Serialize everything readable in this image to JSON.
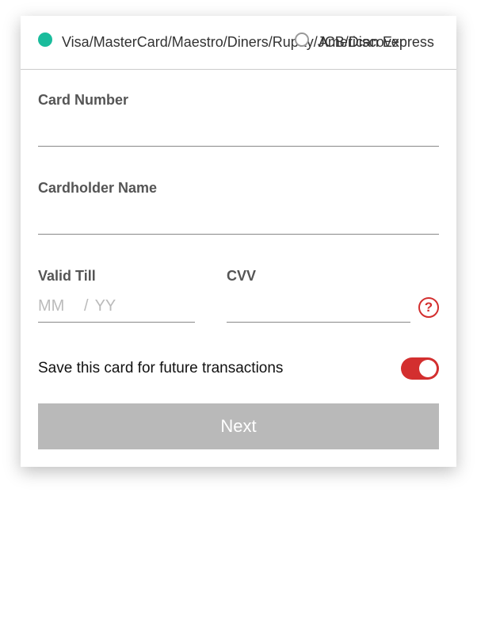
{
  "cardTypes": {
    "option1": "Visa/MasterCard/Maestro/Diners/Rupay/JCB/Discover",
    "option2": "American Express"
  },
  "fields": {
    "cardNumber": {
      "label": "Card Number",
      "value": ""
    },
    "cardholder": {
      "label": "Cardholder Name",
      "value": ""
    },
    "validTill": {
      "label": "Valid Till",
      "mmPlaceholder": "MM",
      "separator": "/",
      "yyPlaceholder": "YY"
    },
    "cvv": {
      "label": "CVV",
      "value": ""
    }
  },
  "help": {
    "symbol": "?"
  },
  "saveCard": {
    "label": "Save this card for future transactions",
    "on": true
  },
  "actions": {
    "next": "Next"
  }
}
